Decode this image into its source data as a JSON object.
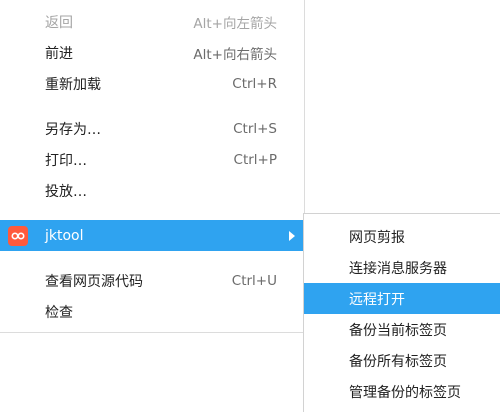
{
  "context_menu": {
    "items": [
      {
        "label": "返回",
        "shortcut": "Alt+向左箭头"
      },
      {
        "label": "前进",
        "shortcut": "Alt+向右箭头"
      },
      {
        "label": "重新加载",
        "shortcut": "Ctrl+R"
      },
      {
        "label": "另存为…",
        "shortcut": "Ctrl+S"
      },
      {
        "label": "打印…",
        "shortcut": "Ctrl+P"
      },
      {
        "label": "投放…"
      },
      {
        "label": "jktool",
        "icon": "jktool-extension-icon"
      },
      {
        "label": "查看网页源代码",
        "shortcut": "Ctrl+U"
      },
      {
        "label": "检查"
      }
    ]
  },
  "submenu": {
    "items": [
      {
        "label": "网页剪报"
      },
      {
        "label": "连接消息服务器"
      },
      {
        "label": "远程打开"
      },
      {
        "label": "备份当前标签页"
      },
      {
        "label": "备份所有标签页"
      },
      {
        "label": "管理备份的标签页"
      }
    ]
  },
  "colors": {
    "highlight": "#2fa3f0",
    "icon_bg": "#ff5a3c",
    "disabled_text": "#a5a5a5"
  }
}
